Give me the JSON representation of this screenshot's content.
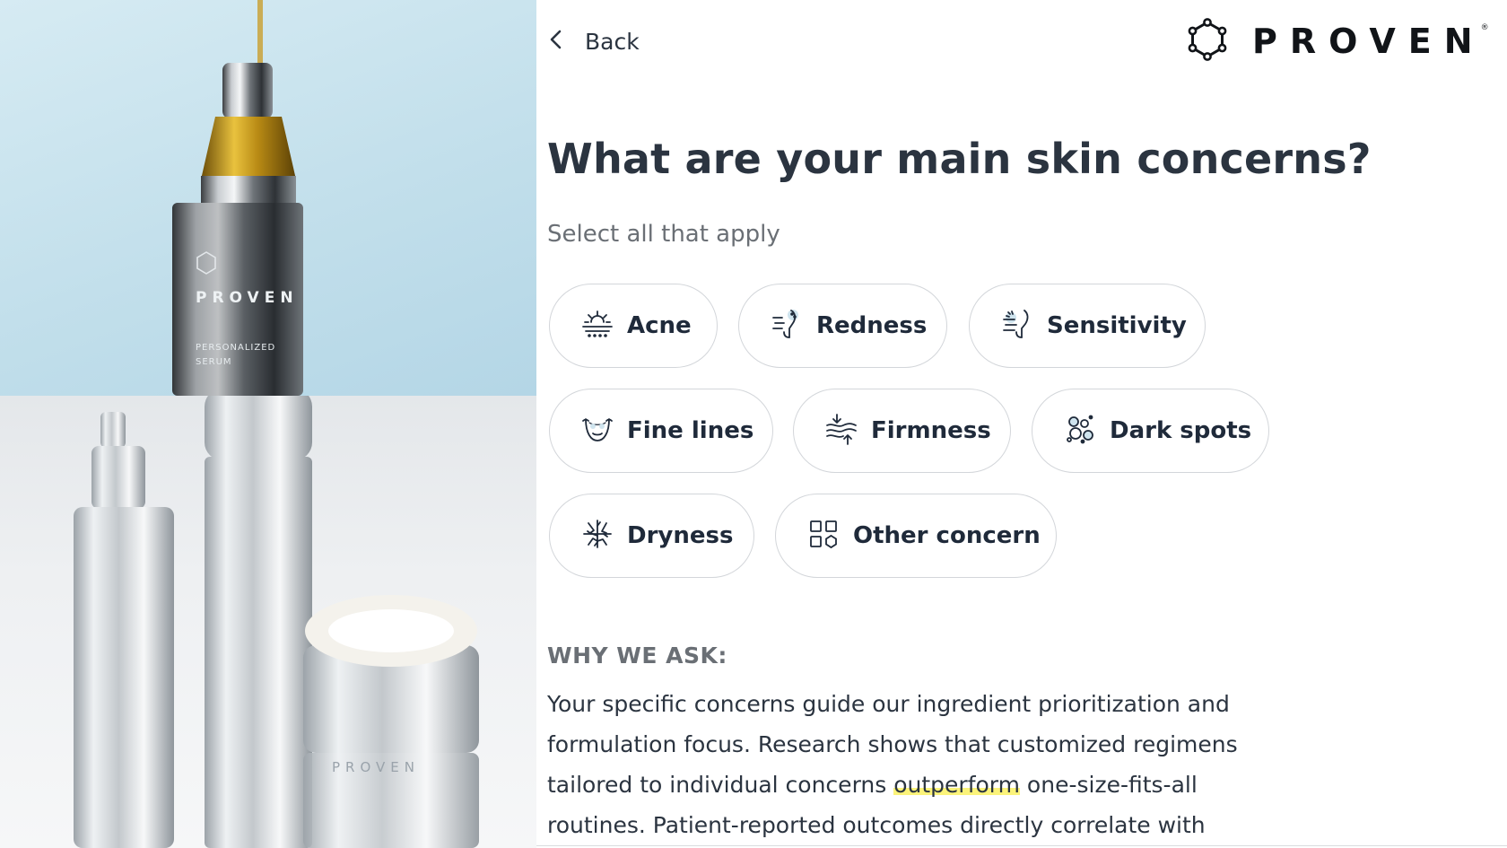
{
  "nav": {
    "back_label": "Back",
    "back_icon": "chevron-left-icon"
  },
  "brand": {
    "logo_text": "PROVEN",
    "registered_mark": "®",
    "logo_icon": "hexagon-molecule-icon"
  },
  "photos": {
    "top_bottle_brand": "PROVEN",
    "top_bottle_subtitle": "PERSONALIZED SERUM",
    "bottom_jar_brand": "PROVEN"
  },
  "question": {
    "title": "What are your main skin concerns?",
    "subtitle": "Select all that apply"
  },
  "concerns": [
    {
      "label": "Acne",
      "icon": "acne-icon"
    },
    {
      "label": "Redness",
      "icon": "redness-icon"
    },
    {
      "label": "Sensitivity",
      "icon": "sensitivity-icon"
    },
    {
      "label": "Fine lines",
      "icon": "fine-lines-icon"
    },
    {
      "label": "Firmness",
      "icon": "firmness-icon"
    },
    {
      "label": "Dark spots",
      "icon": "dark-spots-icon"
    },
    {
      "label": "Dryness",
      "icon": "dryness-icon"
    },
    {
      "label": "Other concern",
      "icon": "other-concern-icon"
    }
  ],
  "why": {
    "heading": "WHY WE ASK:",
    "line1": "Your specific concerns guide our ingredient prioritization and",
    "line2": "formulation focus. Research shows that customized regimens",
    "line3_before": "tailored to individual concerns ",
    "line3_highlight": "outperform",
    "line3_after": " one-size-fits-all",
    "line4": "routines. Patient-reported outcomes directly correlate with"
  },
  "colors": {
    "text_primary": "#2b3440",
    "text_muted": "#6a6f75",
    "chip_border": "#d3d6da",
    "highlight": "#fbf37a"
  }
}
